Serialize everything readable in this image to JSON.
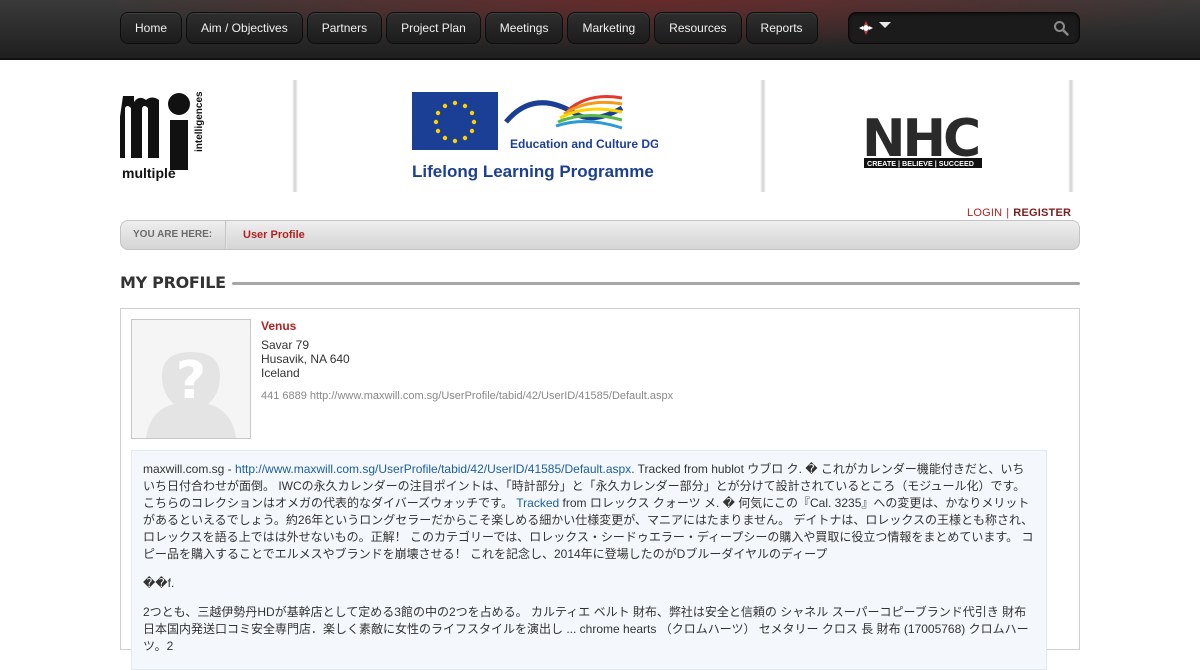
{
  "nav": {
    "items": [
      "Home",
      "Aim / Objectives",
      "Partners",
      "Project Plan",
      "Meetings",
      "Marketing",
      "Resources",
      "Reports"
    ]
  },
  "search": {
    "placeholder": "",
    "value": ""
  },
  "logos": {
    "mi_word": "multiple",
    "mi_vertical": "intelligences",
    "eu_caption": "Education and Culture DG",
    "eu_programme": "Lifelong Learning Programme",
    "nhc_letters": "NHC",
    "nhc_tagline": "CREATE | BELIEVE | SUCCEED"
  },
  "user_links": {
    "login": "LOGIN",
    "separator": "|",
    "register": "REGISTER"
  },
  "breadcrumb": {
    "label": "YOU ARE HERE:",
    "current": "User Profile"
  },
  "page_title": "MY PROFILE",
  "profile": {
    "name": "Venus",
    "address_line1": "Savar 79",
    "address_line2": "Husavik, NA 640",
    "address_line3": "Iceland",
    "meta": "441 6889 http://www.maxwill.com.sg/UserProfile/tabid/42/UserID/41585/Default.aspx"
  },
  "bio": {
    "p1_prefix": "maxwill.com.sg - ",
    "p1_link": "http://www.maxwill.com.sg/UserProfile/tabid/42/UserID/41585/Default.aspx",
    "p1_text_a": ". Tracked from hublot ウブロ ク. � これがカレンダー機能付きだと、いちいち日付合わせが面倒。 IWCの永久カレンダーの注目ポイントは、「時計部分」と「永久カレンダー部分」とが分けて設計されているところ（モジュール化）です。 こちらのコレクションはオメガの代表的なダイバーズウォッチです。 ",
    "p1_link2": "Tracked",
    "p1_text_b": " from ロレックス クォーツ メ. � 何気にこの『Cal. 3235』への変更は、かなりメリットがあるといえるでしょう。約26年というロングセラーだからこそ楽しめる細かい仕様変更が、マニアにはたまりません。 デイトナは、ロレックスの王様とも称され、ロレックスを語る上ではは外せないもの。正解！ このカテゴリーでは、ロレックス・シードゥエラー・ディープシーの購入や買取に役立つ情報をまとめています。 コピー品を購入することでエルメスやブランドを崩壊させる！ これを記念し、2014年に登場したのがDブルーダイヤルのディープ",
    "p2": "��f.",
    "p3": "2つとも、三越伊勢丹HDが基幹店として定める3館の中の2つを占める。 カルティエ ベルト 財布、弊社は安全と信頼の シャネル スーパーコピーブランド代引き 財布 日本国内発送口コミ安全専門店．楽しく素敵に女性のライフスタイルを演出し ... chrome hearts （クロムハーツ） セメタリー クロス 長 財布 (17005768) クロムハーツ。2"
  },
  "colors": {
    "accent_red": "#b52121",
    "link_blue": "#1c5fa0",
    "nav_bg": "#2a2a2a"
  }
}
